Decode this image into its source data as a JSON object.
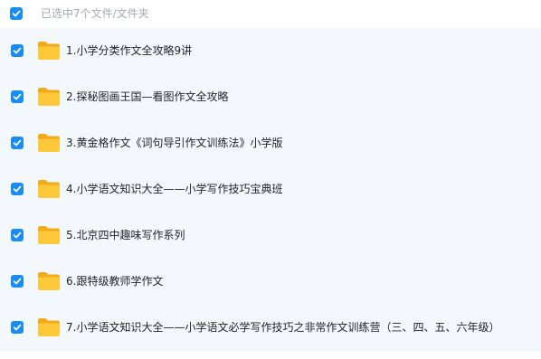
{
  "header": {
    "selection_text": "已选中7个文件/文件夹"
  },
  "files": [
    {
      "name": "1.小学分类作文全攻略9讲",
      "checked": true
    },
    {
      "name": "2.探秘图画王国—看图作文全攻略",
      "checked": true
    },
    {
      "name": "3.黄金格作文《词句导引作文训练法》小学版",
      "checked": true
    },
    {
      "name": "4.小学语文知识大全——小学写作技巧宝典班",
      "checked": true
    },
    {
      "name": "5.北京四中趣味写作系列",
      "checked": true
    },
    {
      "name": "6.跟特级教师学作文",
      "checked": true
    },
    {
      "name": "7.小学语文知识大全——小学语文必学写作技巧之非常作文训练营（三、四、五、六年级）",
      "checked": true
    }
  ],
  "colors": {
    "checkbox": "#1a8df5",
    "folder_body": "#fdc93a",
    "folder_back": "#f3aa19",
    "panel_background": "#f3f8fd"
  },
  "icons": {
    "checkbox": "checkmark-icon",
    "folder": "folder-icon"
  }
}
